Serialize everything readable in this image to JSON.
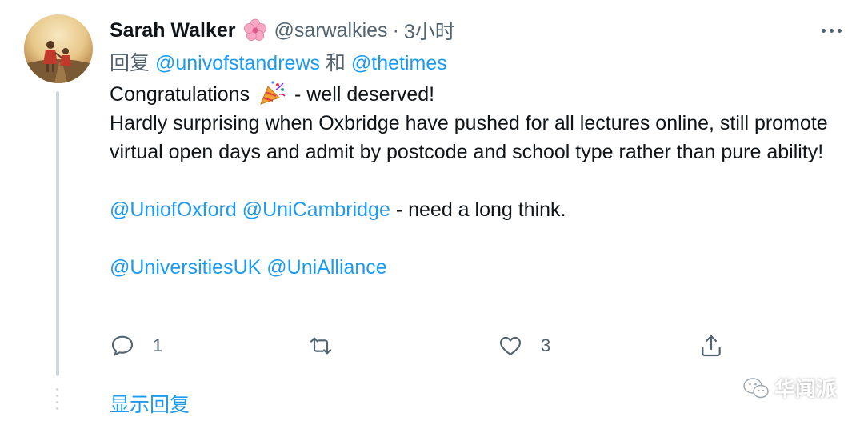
{
  "author": {
    "name": "Sarah Walker",
    "handle": "@sarwalkies",
    "separator": "·",
    "time": "3小时"
  },
  "reply_to": {
    "prefix": "回复",
    "user1": "@univofstandrews",
    "conjunction": "和",
    "user2": "@thetimes"
  },
  "tweet": {
    "line1_before": "Congratulations",
    "line1_after": "- well deserved!",
    "paragraph1": "Hardly surprising when Oxbridge have pushed for all lectures online, still promote virtual open days and admit by postcode and school type rather than pure ability!",
    "mention_oxford": "@UniofOxford",
    "mention_cambridge": "@UniCambridge",
    "paragraph2_after": "- need a long think.",
    "mention_universitiesuk": "@UniversitiesUK",
    "mention_unialliance": "@UniAlliance"
  },
  "actions": {
    "reply_count": "1",
    "retweet_count": "",
    "like_count": "3"
  },
  "show_replies": "显示回复",
  "watermark": "华闻派",
  "icons": {
    "reply": "comment-icon",
    "retweet": "retweet-icon",
    "like": "heart-icon",
    "share": "share-icon",
    "more": "more-horizontal-icon",
    "name_emoji": "cherry-blossom-icon",
    "text_emoji": "party-popper-icon"
  },
  "colors": {
    "link": "#1d9bf0",
    "secondary_text": "#536471",
    "primary_text": "#0f1419",
    "thread_line": "#cfd9de"
  }
}
